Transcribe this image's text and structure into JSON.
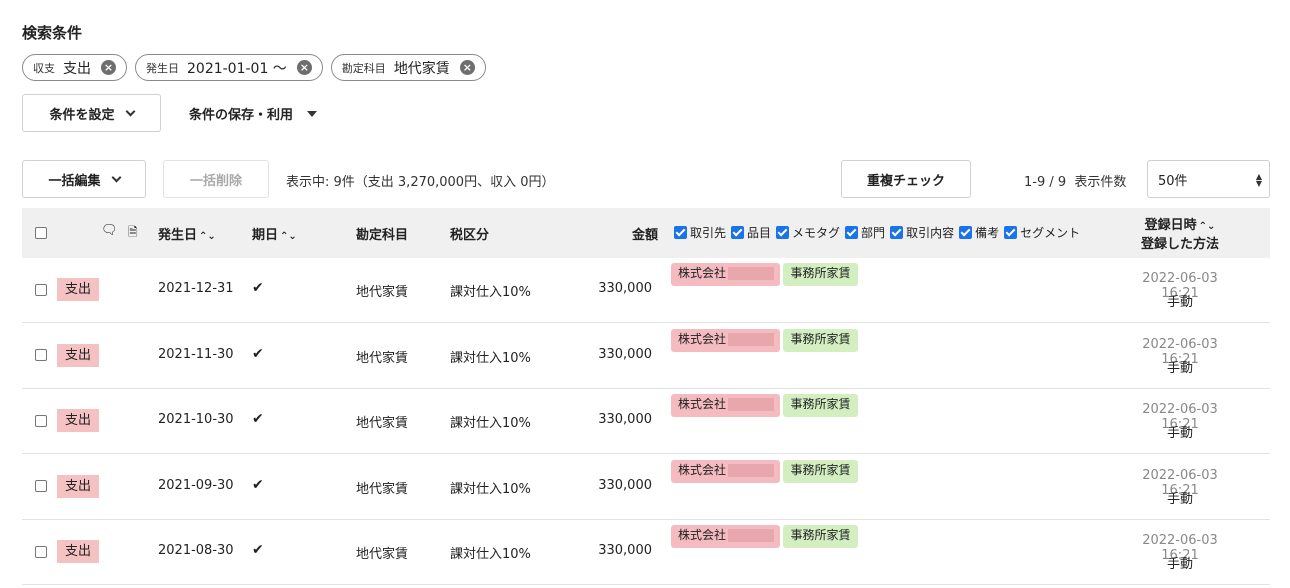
{
  "search": {
    "title": "検索条件",
    "chips": [
      {
        "key": "収支",
        "value": "支出"
      },
      {
        "key": "発生日",
        "value": "2021-01-01 〜"
      },
      {
        "key": "勘定科目",
        "value": "地代家賃"
      }
    ],
    "set_conditions_label": "条件を設定",
    "save_use_label": "条件の保存・利用"
  },
  "toolbar": {
    "bulk_edit_label": "一括編集",
    "bulk_delete_label": "一括削除",
    "summary": "表示中: 9件（支出 3,270,000円、収入 0円）",
    "duplicate_check_label": "重複チェック",
    "pager": "1-9 / 9  表示件数",
    "page_size": "50件"
  },
  "table": {
    "headers": {
      "date": "発生日",
      "due": "期日",
      "account": "勘定科目",
      "tax": "税区分",
      "amount": "金額",
      "toggles": [
        "取引先",
        "品目",
        "メモタグ",
        "部門",
        "取引内容",
        "備考",
        "セグメント"
      ],
      "registered_1": "登録日時",
      "registered_2": "登録した方法"
    },
    "rows": [
      {
        "type": "支出",
        "date": "2021-12-31",
        "account": "地代家賃",
        "tax": "課対仕入10%",
        "amount": "330,000",
        "partner": "株式会社",
        "item": "事務所家賃",
        "registered": "2022-06-03 16:21",
        "method": "手動"
      },
      {
        "type": "支出",
        "date": "2021-11-30",
        "account": "地代家賃",
        "tax": "課対仕入10%",
        "amount": "330,000",
        "partner": "株式会社",
        "item": "事務所家賃",
        "registered": "2022-06-03 16:21",
        "method": "手動"
      },
      {
        "type": "支出",
        "date": "2021-10-30",
        "account": "地代家賃",
        "tax": "課対仕入10%",
        "amount": "330,000",
        "partner": "株式会社",
        "item": "事務所家賃",
        "registered": "2022-06-03 16:21",
        "method": "手動"
      },
      {
        "type": "支出",
        "date": "2021-09-30",
        "account": "地代家賃",
        "tax": "課対仕入10%",
        "amount": "330,000",
        "partner": "株式会社",
        "item": "事務所家賃",
        "registered": "2022-06-03 16:21",
        "method": "手動"
      },
      {
        "type": "支出",
        "date": "2021-08-30",
        "account": "地代家賃",
        "tax": "課対仕入10%",
        "amount": "330,000",
        "partner": "株式会社",
        "item": "事務所家賃",
        "registered": "2022-06-03 16:21",
        "method": "手動"
      }
    ]
  }
}
